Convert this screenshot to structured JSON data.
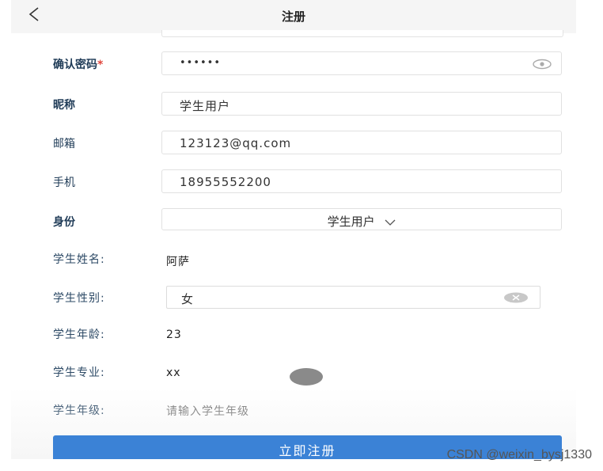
{
  "header": {
    "title": "注册",
    "back_icon": "chevron-left-icon"
  },
  "form": {
    "confirm_password": {
      "label": "确认密码",
      "required_mark": "*",
      "value": "••••••",
      "icon": "eye-icon"
    },
    "nickname": {
      "label": "昵称",
      "value": "学生用户"
    },
    "email": {
      "label": "邮箱",
      "value": "123123@qq.com"
    },
    "phone": {
      "label": "手机",
      "value": "18955552200"
    },
    "role": {
      "label": "身份",
      "value": "学生用户",
      "icon": "chevron-down-icon"
    },
    "student_name": {
      "label": "学生姓名:",
      "value": "阿萨"
    },
    "student_gender": {
      "label": "学生性别:",
      "value": "女",
      "icon": "clear-icon"
    },
    "student_age": {
      "label": "学生年龄:",
      "value": "23"
    },
    "student_major": {
      "label": "学生专业:",
      "value": "xx"
    },
    "student_grade": {
      "label": "学生年级:",
      "placeholder": "请输入学生年级"
    }
  },
  "submit_label": "立即注册",
  "watermark": "CSDN @weixin_bysj1330",
  "colors": {
    "accent": "#3b82d6",
    "required": "#e0463c",
    "label": "#1f3b57"
  }
}
